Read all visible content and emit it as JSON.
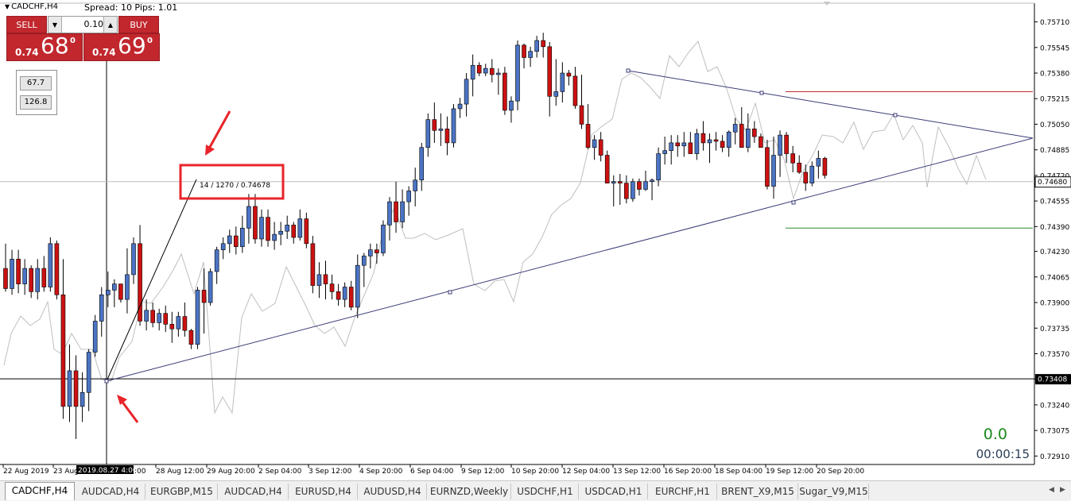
{
  "header": {
    "symbol_title": "CADCHF,H4",
    "spread_text": "Spread: 10  Pips: 1.01"
  },
  "trade_panel": {
    "sell_label": "SELL",
    "buy_label": "BUY",
    "lot_value": "0.10",
    "sell_prefix": "0.74",
    "sell_big": "68",
    "sell_sup": "0",
    "buy_prefix": "0.74",
    "buy_big": "69",
    "buy_sup": "0"
  },
  "indicators": [
    "67.7",
    "126.8"
  ],
  "annotation": {
    "label": "14 / 1270 / 0.74678"
  },
  "counter": {
    "value": "0.0",
    "time": "00:00:15"
  },
  "crosshair_date_label": "2019.08.27 4:00",
  "tabs": [
    "CADCHF,H4",
    "AUDCAD,H4",
    "EURGBP,M15",
    "AUDCAD,H4",
    "EURUSD,H4",
    "AUDUSD,H4",
    "EURNZD,Weekly",
    "USDCHF,H1",
    "USDCAD,H1",
    "EURCHF,H1",
    "BRENT_X9,M15",
    "Sugar_V9,M15"
  ],
  "colors": {
    "bull": "#4b74c4",
    "bear": "#cc1111",
    "trendline": "#3c3c78",
    "ghost_line": "#bfbfbf",
    "resistance": "#c03030",
    "support": "#2a8a2a",
    "arrow": "#e8242a"
  },
  "chart_data": {
    "type": "candlestick",
    "symbol": "CADCHF",
    "timeframe": "H4",
    "ylim": [
      0.7283,
      0.758
    ],
    "y_ticks": [
      "0.75710",
      "0.75545",
      "0.75380",
      "0.75215",
      "0.75050",
      "0.74885",
      "0.74720",
      "0.74555",
      "0.74390",
      "0.74230",
      "0.74065",
      "0.73900",
      "0.73735",
      "0.73570",
      "0.73405",
      "0.73240",
      "0.73075",
      "0.72910"
    ],
    "x_labels": [
      "22 Aug 2019",
      "23 Aug",
      "28 Aug 12:00",
      "29 Aug 20:00",
      "2 Sep 04:00",
      "3 Sep 12:00",
      "4 Sep 20:00",
      "6 Sep 04:00",
      "9 Sep 12:00",
      "10 Sep 20:00",
      "12 Sep 04:00",
      "13 Sep 12:00",
      "16 Sep 20:00",
      "18 Sep 04:00",
      "19 Sep 12:00",
      "20 Sep 20:00"
    ],
    "hidden_x_label": ":00",
    "current_price": "0.74680",
    "horizontal_line_price": "0.73408",
    "resistance_level": 0.7526,
    "support_level": 0.7438,
    "candles": [
      [
        0.7412,
        0.7428,
        0.7397,
        0.7399
      ],
      [
        0.7399,
        0.7424,
        0.7395,
        0.7418
      ],
      [
        0.7418,
        0.7424,
        0.7396,
        0.7402
      ],
      [
        0.7402,
        0.7418,
        0.7395,
        0.7412
      ],
      [
        0.7412,
        0.7414,
        0.7393,
        0.7397
      ],
      [
        0.7397,
        0.7418,
        0.7392,
        0.7412
      ],
      [
        0.7412,
        0.742,
        0.7397,
        0.74
      ],
      [
        0.74,
        0.7432,
        0.7397,
        0.7428
      ],
      [
        0.7428,
        0.743,
        0.7392,
        0.7395
      ],
      [
        0.7395,
        0.7418,
        0.7315,
        0.7323
      ],
      [
        0.7323,
        0.7363,
        0.7313,
        0.7346
      ],
      [
        0.7346,
        0.7356,
        0.7302,
        0.7323
      ],
      [
        0.7323,
        0.7345,
        0.7313,
        0.7332
      ],
      [
        0.7332,
        0.736,
        0.732,
        0.7358
      ],
      [
        0.7358,
        0.7382,
        0.7355,
        0.7378
      ],
      [
        0.7378,
        0.74,
        0.7368,
        0.7395
      ],
      [
        0.7395,
        0.741,
        0.7387,
        0.7398
      ],
      [
        0.7398,
        0.7405,
        0.7387,
        0.7402
      ],
      [
        0.7402,
        0.7402,
        0.739,
        0.7392
      ],
      [
        0.7392,
        0.7425,
        0.7383,
        0.7408
      ],
      [
        0.7408,
        0.7432,
        0.7402,
        0.7428
      ],
      [
        0.7428,
        0.744,
        0.7375,
        0.7378
      ],
      [
        0.7378,
        0.7392,
        0.7372,
        0.7385
      ],
      [
        0.7385,
        0.739,
        0.7374,
        0.7377
      ],
      [
        0.7377,
        0.7386,
        0.7372,
        0.7383
      ],
      [
        0.7383,
        0.7388,
        0.7371,
        0.7376
      ],
      [
        0.7376,
        0.7384,
        0.7364,
        0.7373
      ],
      [
        0.7373,
        0.7384,
        0.7368,
        0.7381
      ],
      [
        0.7381,
        0.739,
        0.7368,
        0.7372
      ],
      [
        0.7372,
        0.7373,
        0.736,
        0.7363
      ],
      [
        0.7363,
        0.74,
        0.736,
        0.7398
      ],
      [
        0.7398,
        0.7412,
        0.737,
        0.739
      ],
      [
        0.739,
        0.7412,
        0.7388,
        0.741
      ],
      [
        0.741,
        0.7426,
        0.7402,
        0.7424
      ],
      [
        0.7424,
        0.7432,
        0.7418,
        0.7428
      ],
      [
        0.7428,
        0.7437,
        0.7422,
        0.7433
      ],
      [
        0.7433,
        0.7439,
        0.7421,
        0.7426
      ],
      [
        0.7426,
        0.7446,
        0.7422,
        0.7438
      ],
      [
        0.7438,
        0.746,
        0.7428,
        0.7452
      ],
      [
        0.7452,
        0.746,
        0.7428,
        0.7431
      ],
      [
        0.7431,
        0.745,
        0.7426,
        0.7445
      ],
      [
        0.7445,
        0.745,
        0.7426,
        0.743
      ],
      [
        0.743,
        0.7442,
        0.7424,
        0.7434
      ],
      [
        0.7434,
        0.7442,
        0.7427,
        0.7436
      ],
      [
        0.7436,
        0.7446,
        0.7431,
        0.744
      ],
      [
        0.744,
        0.7442,
        0.7428,
        0.7432
      ],
      [
        0.7432,
        0.745,
        0.743,
        0.7444
      ],
      [
        0.7444,
        0.7448,
        0.7425,
        0.7428
      ],
      [
        0.7428,
        0.7433,
        0.7396,
        0.7401
      ],
      [
        0.7401,
        0.7416,
        0.7393,
        0.7408
      ],
      [
        0.7408,
        0.7417,
        0.7392,
        0.7402
      ],
      [
        0.7402,
        0.7408,
        0.7392,
        0.7397
      ],
      [
        0.7397,
        0.7402,
        0.7388,
        0.7392
      ],
      [
        0.7392,
        0.7403,
        0.7387,
        0.74
      ],
      [
        0.74,
        0.7404,
        0.7385,
        0.7387
      ],
      [
        0.7387,
        0.7421,
        0.738,
        0.7414
      ],
      [
        0.7414,
        0.7422,
        0.74,
        0.742
      ],
      [
        0.742,
        0.7428,
        0.7412,
        0.7424
      ],
      [
        0.7424,
        0.7428,
        0.7415,
        0.7422
      ],
      [
        0.7422,
        0.7443,
        0.742,
        0.744
      ],
      [
        0.744,
        0.7458,
        0.743,
        0.7455
      ],
      [
        0.7455,
        0.7468,
        0.7435,
        0.7442
      ],
      [
        0.7442,
        0.7463,
        0.7438,
        0.7455
      ],
      [
        0.7455,
        0.7465,
        0.7446,
        0.7462
      ],
      [
        0.7462,
        0.7477,
        0.7452,
        0.7469
      ],
      [
        0.7469,
        0.7493,
        0.7462,
        0.749
      ],
      [
        0.749,
        0.7512,
        0.7484,
        0.7508
      ],
      [
        0.7508,
        0.7519,
        0.7493,
        0.7501
      ],
      [
        0.7501,
        0.7512,
        0.7491,
        0.7502
      ],
      [
        0.7502,
        0.751,
        0.7485,
        0.7493
      ],
      [
        0.7493,
        0.7518,
        0.749,
        0.7515
      ],
      [
        0.7515,
        0.7522,
        0.7509,
        0.7518
      ],
      [
        0.7518,
        0.7538,
        0.751,
        0.7534
      ],
      [
        0.7534,
        0.755,
        0.7523,
        0.7543
      ],
      [
        0.7543,
        0.7545,
        0.7536,
        0.7538
      ],
      [
        0.7538,
        0.7544,
        0.7536,
        0.7541
      ],
      [
        0.7541,
        0.7547,
        0.7532,
        0.7537
      ],
      [
        0.7537,
        0.7541,
        0.7524,
        0.7538
      ],
      [
        0.7538,
        0.7542,
        0.7511,
        0.7514
      ],
      [
        0.7514,
        0.7523,
        0.7506,
        0.752
      ],
      [
        0.752,
        0.7559,
        0.7514,
        0.7556
      ],
      [
        0.7556,
        0.7557,
        0.7541,
        0.7548
      ],
      [
        0.7548,
        0.7555,
        0.7542,
        0.7552
      ],
      [
        0.7552,
        0.7562,
        0.7548,
        0.7559
      ],
      [
        0.7559,
        0.7564,
        0.7548,
        0.7555
      ],
      [
        0.7555,
        0.7558,
        0.751,
        0.7523
      ],
      [
        0.7523,
        0.7547,
        0.7517,
        0.7526
      ],
      [
        0.7526,
        0.7545,
        0.7519,
        0.7538
      ],
      [
        0.7538,
        0.754,
        0.753,
        0.7536
      ],
      [
        0.7536,
        0.7542,
        0.7515,
        0.7517
      ],
      [
        0.7517,
        0.7537,
        0.7502,
        0.7505
      ],
      [
        0.7505,
        0.7518,
        0.7489,
        0.749
      ],
      [
        0.749,
        0.7498,
        0.7482,
        0.7495
      ],
      [
        0.7495,
        0.75,
        0.7481,
        0.7485
      ],
      [
        0.7485,
        0.7488,
        0.7467,
        0.7467
      ],
      [
        0.7467,
        0.7472,
        0.7452,
        0.7468
      ],
      [
        0.7468,
        0.7473,
        0.7453,
        0.7467
      ],
      [
        0.7467,
        0.7472,
        0.7454,
        0.7457
      ],
      [
        0.7457,
        0.747,
        0.7455,
        0.7468
      ],
      [
        0.7468,
        0.747,
        0.7459,
        0.7463
      ],
      [
        0.7463,
        0.7475,
        0.7462,
        0.7468
      ],
      [
        0.7468,
        0.747,
        0.7456,
        0.7469
      ],
      [
        0.7469,
        0.749,
        0.7465,
        0.7486
      ],
      [
        0.7486,
        0.7497,
        0.7479,
        0.7488
      ],
      [
        0.7488,
        0.7498,
        0.7479,
        0.7493
      ],
      [
        0.7493,
        0.7498,
        0.7484,
        0.7491
      ],
      [
        0.7491,
        0.75,
        0.7484,
        0.7493
      ],
      [
        0.7493,
        0.75,
        0.7486,
        0.7486
      ],
      [
        0.7486,
        0.7502,
        0.7482,
        0.7499
      ],
      [
        0.7499,
        0.7507,
        0.7488,
        0.7493
      ],
      [
        0.7493,
        0.7499,
        0.748,
        0.7495
      ],
      [
        0.7495,
        0.75,
        0.7488,
        0.7494
      ],
      [
        0.7494,
        0.7498,
        0.7487,
        0.749
      ],
      [
        0.749,
        0.7501,
        0.7484,
        0.75
      ],
      [
        0.75,
        0.7509,
        0.7492,
        0.7505
      ],
      [
        0.7505,
        0.7516,
        0.75,
        0.749
      ],
      [
        0.749,
        0.7512,
        0.7487,
        0.7502
      ],
      [
        0.7502,
        0.7507,
        0.7493,
        0.7497
      ],
      [
        0.7497,
        0.7499,
        0.749,
        0.749
      ],
      [
        0.749,
        0.7495,
        0.7463,
        0.7465
      ],
      [
        0.7465,
        0.7497,
        0.7457,
        0.7485
      ],
      [
        0.7485,
        0.7501,
        0.7471,
        0.7498
      ],
      [
        0.7498,
        0.75,
        0.748,
        0.7486
      ],
      [
        0.7486,
        0.7491,
        0.7474,
        0.748
      ],
      [
        0.748,
        0.7485,
        0.7473,
        0.7474
      ],
      [
        0.7474,
        0.7479,
        0.7462,
        0.7467
      ],
      [
        0.7467,
        0.7481,
        0.7465,
        0.7478
      ],
      [
        0.7478,
        0.7488,
        0.747,
        0.7483
      ],
      [
        0.7483,
        0.7484,
        0.747,
        0.7472
      ]
    ]
  }
}
